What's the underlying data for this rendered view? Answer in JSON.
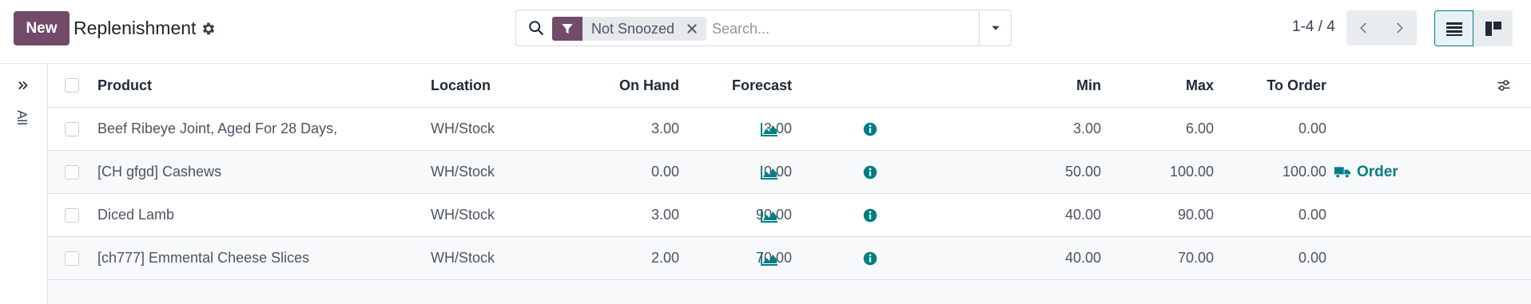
{
  "control_panel": {
    "new_label": "New",
    "title": "Replenishment",
    "search": {
      "facet_label": "Not Snoozed",
      "placeholder": "Search..."
    },
    "pager": {
      "value": "1-4 / 4"
    }
  },
  "side_panel": {
    "label": "All"
  },
  "table": {
    "headers": {
      "product": "Product",
      "location": "Location",
      "on_hand": "On Hand",
      "forecast": "Forecast",
      "min": "Min",
      "max": "Max",
      "to_order": "To Order"
    },
    "rows": [
      {
        "product": "Beef Ribeye Joint, Aged For 28 Days,",
        "location": "WH/Stock",
        "on_hand": "3.00",
        "forecast": "3.00",
        "min": "3.00",
        "max": "6.00",
        "to_order": "0.00",
        "order": ""
      },
      {
        "product": "[CH gfgd] Cashews",
        "location": "WH/Stock",
        "on_hand": "0.00",
        "forecast": "0.00",
        "min": "50.00",
        "max": "100.00",
        "to_order": "100.00",
        "order": "Order"
      },
      {
        "product": "Diced Lamb",
        "location": "WH/Stock",
        "on_hand": "3.00",
        "forecast": "90.00",
        "min": "40.00",
        "max": "90.00",
        "to_order": "0.00",
        "order": ""
      },
      {
        "product": "[ch777] Emmental Cheese Slices",
        "location": "WH/Stock",
        "on_hand": "2.00",
        "forecast": "70.00",
        "min": "40.00",
        "max": "70.00",
        "to_order": "0.00",
        "order": ""
      }
    ]
  },
  "icons": {
    "title": "gear-icon",
    "search": "search-icon",
    "facet": "filter-icon",
    "facet_remove": "close-icon",
    "search_toggle": "caret-down-icon",
    "pager_prev": "chevron-left-icon",
    "pager_next": "chevron-right-icon",
    "view_list": "list-view-icon",
    "view_kanban": "kanban-view-icon",
    "side_toggle": "double-chevron-right-icon",
    "forecast_graph": "area-chart-icon",
    "info": "info-circle-icon",
    "order": "truck-icon",
    "optional_columns": "sliders-icon"
  },
  "colors": {
    "brand": "#714b67",
    "accent": "#017e84",
    "facet_bg": "#e7e9ed"
  }
}
